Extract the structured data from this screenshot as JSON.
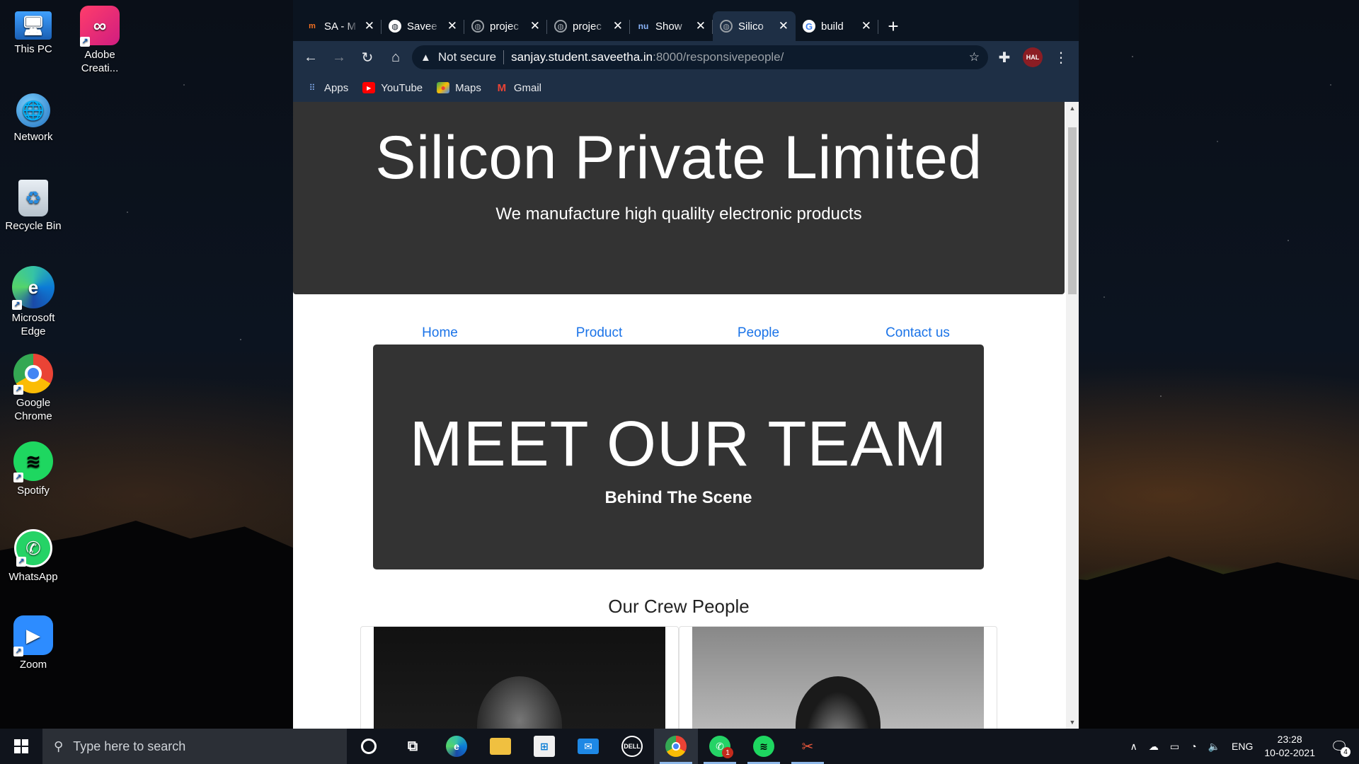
{
  "desktop": {
    "icons": [
      {
        "label": "This PC",
        "icon": "computer-icon"
      },
      {
        "label": "Adobe Creati...",
        "icon": "adobe-cc-icon"
      },
      {
        "label": "Network",
        "icon": "network-icon"
      },
      {
        "label": "Recycle Bin",
        "icon": "recycle-bin-icon"
      },
      {
        "label": "Microsoft Edge",
        "icon": "edge-icon"
      },
      {
        "label": "Google Chrome",
        "icon": "chrome-icon"
      },
      {
        "label": "Spotify",
        "icon": "spotify-icon"
      },
      {
        "label": "WhatsApp",
        "icon": "whatsapp-icon"
      },
      {
        "label": "Zoom",
        "icon": "zoom-icon"
      }
    ]
  },
  "browser": {
    "tabs": [
      {
        "title": "SA - M",
        "favicon": "m-icon"
      },
      {
        "title": "Savee",
        "favicon": "globe-icon"
      },
      {
        "title": "projec",
        "favicon": "globe-icon"
      },
      {
        "title": "projec",
        "favicon": "globe-icon"
      },
      {
        "title": "Show",
        "favicon": "nu-icon"
      },
      {
        "title": "Silico",
        "favicon": "globe-icon",
        "active": true
      },
      {
        "title": "build",
        "favicon": "google-icon"
      }
    ],
    "security_label": "Not secure",
    "url_host": "sanjay.student.saveetha.in",
    "url_rest": ":8000/responsivepeople/",
    "avatar_text": "HAL",
    "bookmarks": [
      {
        "label": "Apps",
        "icon": "apps-grid-icon"
      },
      {
        "label": "YouTube",
        "icon": "youtube-icon"
      },
      {
        "label": "Maps",
        "icon": "maps-icon"
      },
      {
        "label": "Gmail",
        "icon": "gmail-icon"
      }
    ]
  },
  "page": {
    "company_title": "Silicon Private Limited",
    "tagline": "We manufacture high qualilty electronic products",
    "nav": [
      "Home",
      "Product",
      "People",
      "Contact us"
    ],
    "team_heading": "MEET OUR TEAM",
    "team_subheading": "Behind The Scene",
    "crew_title": "Our Crew People"
  },
  "taskbar": {
    "search_placeholder": "Type here to search",
    "apps": [
      {
        "icon": "cortana-icon"
      },
      {
        "icon": "task-view-icon"
      },
      {
        "icon": "edge-icon"
      },
      {
        "icon": "file-explorer-icon"
      },
      {
        "icon": "store-icon"
      },
      {
        "icon": "mail-icon"
      },
      {
        "icon": "dell-icon"
      },
      {
        "icon": "chrome-icon",
        "active": true
      },
      {
        "icon": "whatsapp-icon",
        "badge": "1"
      },
      {
        "icon": "spotify-icon"
      },
      {
        "icon": "snip-icon"
      }
    ],
    "language": "ENG",
    "time": "23:28",
    "date": "10-02-2021",
    "notification_count": "4"
  },
  "colors": {
    "link": "#1a73e8",
    "dark_panel": "#333333",
    "chrome_frame": "#1e2f45"
  }
}
